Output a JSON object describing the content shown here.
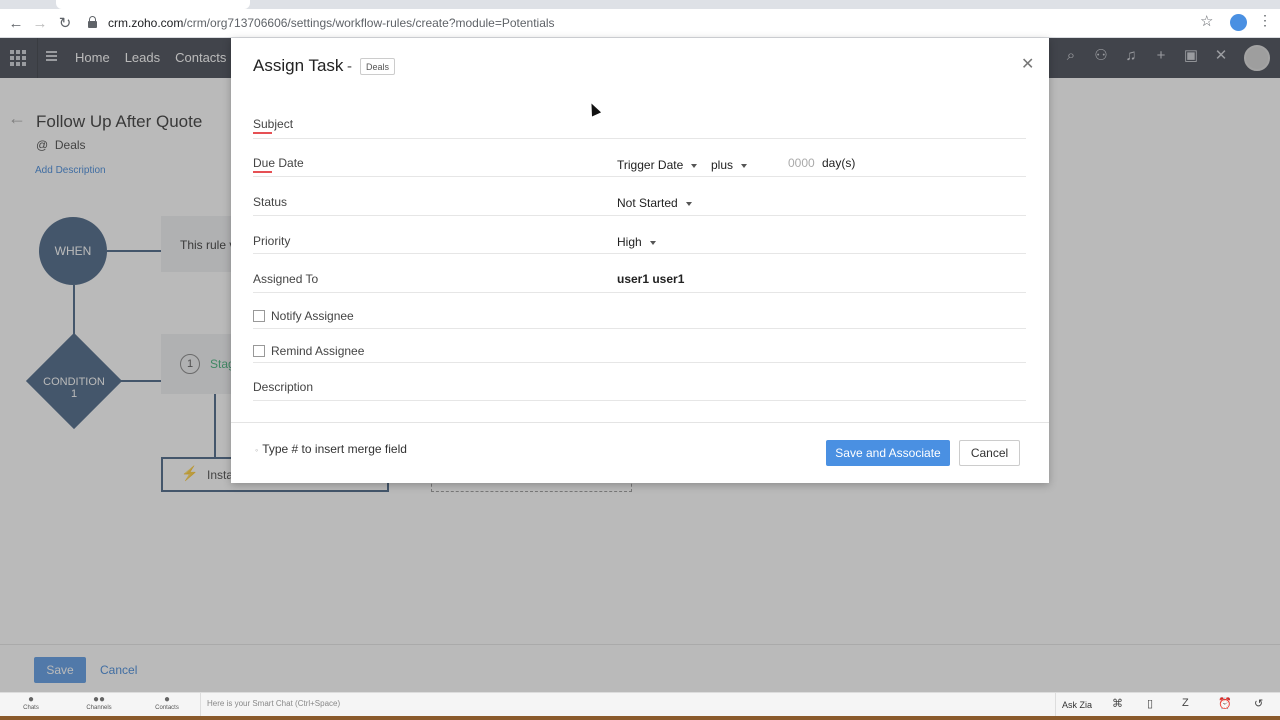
{
  "browser": {
    "url_host": "crm.zoho.com",
    "url_path": "/crm/org713706606/settings/workflow-rules/create?module=Potentials"
  },
  "app_header": {
    "nav": [
      "Home",
      "Leads",
      "Contacts"
    ]
  },
  "page": {
    "rule_title": "Follow Up After Quote",
    "rule_module": "Deals",
    "add_description": "Add Description",
    "when_label": "WHEN",
    "rule_box_text": "This rule v",
    "condition_label_line1": "CONDITION",
    "condition_label_line2": "1",
    "stage_number": "1",
    "stage_text": "Stag",
    "instant_text": "Insta",
    "save_label": "Save",
    "cancel_label": "Cancel"
  },
  "bottom_bar": {
    "chats": "Chats",
    "channels": "Channels",
    "contacts": "Contacts",
    "smart_chat_placeholder": "Here is your Smart Chat (Ctrl+Space)",
    "ask_zia": "Ask Zia"
  },
  "modal": {
    "title": "Assign Task",
    "separator": "-",
    "module_badge": "Deals",
    "fields": {
      "subject_label": "Subject",
      "due_date_label": "Due Date",
      "due_date_trigger": "Trigger Date",
      "due_date_operator": "plus",
      "due_date_days_placeholder": "0000",
      "due_date_unit": "day(s)",
      "status_label": "Status",
      "status_value": "Not Started",
      "priority_label": "Priority",
      "priority_value": "High",
      "assigned_to_label": "Assigned To",
      "assigned_to_value": "user1 user1",
      "notify_assignee": "Notify Assignee",
      "remind_assignee": "Remind Assignee",
      "description_label": "Description"
    },
    "footer": {
      "merge_hint": "Type # to insert merge field",
      "save_associate": "Save and Associate",
      "cancel": "Cancel"
    }
  },
  "colors": {
    "primary_button": "#4a90e2",
    "header_bg": "#2f3440",
    "flow_node": "#355477",
    "required_marker": "#e65054"
  }
}
